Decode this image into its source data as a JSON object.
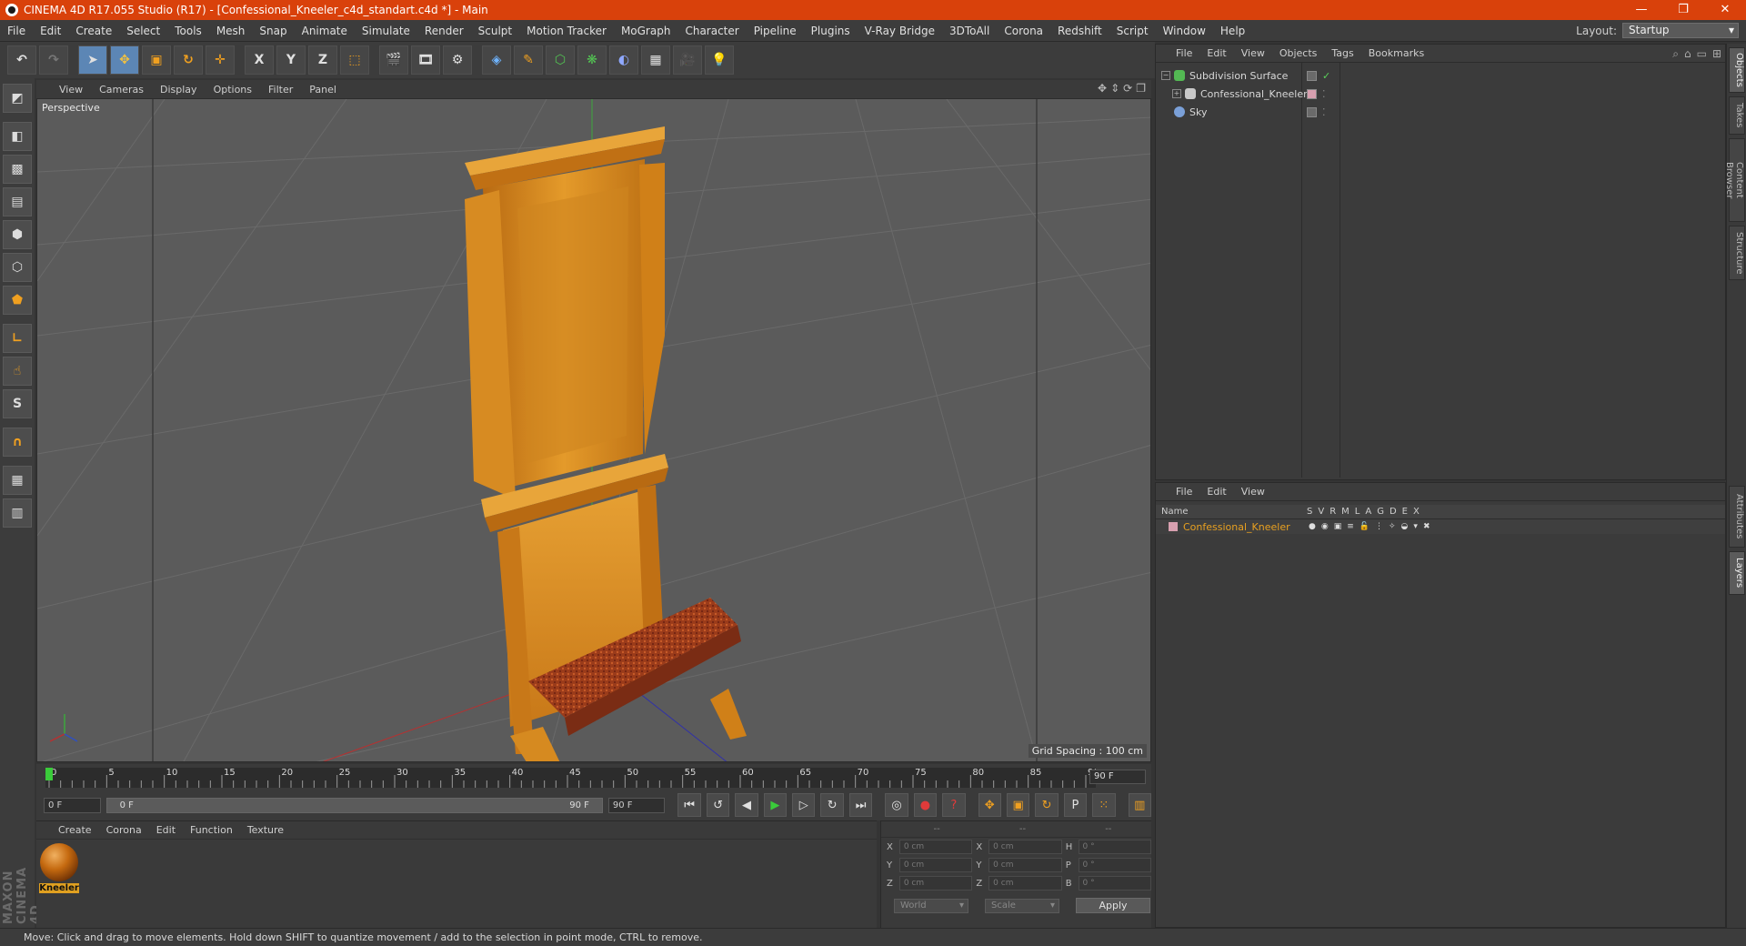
{
  "title_bar": {
    "text": "CINEMA 4D R17.055 Studio (R17) - [Confessional_Kneeler_c4d_standart.c4d *] - Main",
    "controls": [
      "—",
      "❐",
      "✕"
    ]
  },
  "menu": [
    "File",
    "Edit",
    "Create",
    "Select",
    "Tools",
    "Mesh",
    "Snap",
    "Animate",
    "Simulate",
    "Render",
    "Sculpt",
    "Motion Tracker",
    "MoGraph",
    "Character",
    "Pipeline",
    "Plugins",
    "V-Ray Bridge",
    "3DToAll",
    "Corona",
    "Redshift",
    "Script",
    "Window",
    "Help"
  ],
  "layout": {
    "label": "Layout:",
    "value": "Startup"
  },
  "toolbar": {
    "axis_x": "X",
    "axis_y": "Y",
    "axis_z": "Z"
  },
  "viewport": {
    "menu": [
      "View",
      "Cameras",
      "Display",
      "Options",
      "Filter",
      "Panel"
    ],
    "label": "Perspective",
    "grid_spacing": "Grid Spacing : 100 cm"
  },
  "timeline": {
    "ticks": [
      "0",
      "5",
      "10",
      "15",
      "20",
      "25",
      "30",
      "35",
      "40",
      "45",
      "50",
      "55",
      "60",
      "65",
      "70",
      "75",
      "80",
      "85",
      "90"
    ],
    "end_frame": "90 F"
  },
  "transport": {
    "start": "0 F",
    "range_left": "0 F",
    "range_right": "90 F",
    "end": "90 F"
  },
  "material_panel": {
    "menu": [
      "Create",
      "Corona",
      "Edit",
      "Function",
      "Texture"
    ],
    "material_name": "Kneeler"
  },
  "coords": {
    "header": [
      "--",
      "--",
      "--"
    ],
    "rows": [
      [
        "X",
        "0 cm",
        "X",
        "0 cm",
        "H",
        "0 °"
      ],
      [
        "Y",
        "0 cm",
        "Y",
        "0 cm",
        "P",
        "0 °"
      ],
      [
        "Z",
        "0 cm",
        "Z",
        "0 cm",
        "B",
        "0 °"
      ]
    ],
    "mode": "World",
    "size_mode": "Scale",
    "apply": "Apply"
  },
  "objects_panel": {
    "menu": [
      "File",
      "Edit",
      "View",
      "Objects",
      "Tags",
      "Bookmarks"
    ],
    "items": [
      {
        "name": "Subdivision Surface",
        "color": "#53b953"
      },
      {
        "name": "Confessional_Kneeler",
        "color": "#c8c8c8"
      },
      {
        "name": "Sky",
        "color": "#7aa0d8"
      }
    ]
  },
  "layers_panel": {
    "menu": [
      "File",
      "Edit",
      "View"
    ],
    "header": {
      "name": "Name",
      "cols": [
        "S",
        "V",
        "R",
        "M",
        "L",
        "A",
        "G",
        "D",
        "E",
        "X"
      ]
    },
    "layer": "Confessional_Kneeler"
  },
  "right_tabs": [
    "Objects",
    "Takes",
    "Content Browser",
    "Structure",
    "Attributes",
    "Layers"
  ],
  "status": "Move: Click and drag to move elements. Hold down SHIFT to quantize movement / add to the selection in point mode, CTRL to remove.",
  "branding": "MAXON CINEMA 4D",
  "colors": {
    "titlebar": "#d9410b",
    "accent_layer": "#e8a020",
    "wood": "#d88a1e"
  }
}
